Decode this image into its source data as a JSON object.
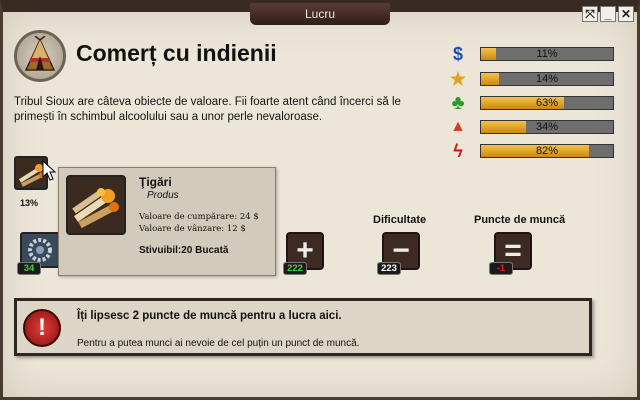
{
  "window": {
    "title": "Lucru",
    "controls": [
      {
        "name": "settings-icon",
        "glyph": "⤧"
      },
      {
        "name": "minimize-icon",
        "glyph": "_"
      },
      {
        "name": "close-icon",
        "glyph": "✕"
      }
    ]
  },
  "job": {
    "icon": "tepee-icon",
    "title": "Comerț cu indienii",
    "description": "Tribul Sioux are câteva obiecte de valoare. Fii foarte atent când încerci să le primești în schimbul alcoolului sau a unor perle nevaloroase."
  },
  "stats": [
    {
      "icon": "dollar-icon",
      "glyph": "$",
      "color": "#1d4fb8",
      "label": "11%",
      "value": 11
    },
    {
      "icon": "star-icon",
      "glyph": "★",
      "color": "#e0a21a",
      "label": "14%",
      "value": 14
    },
    {
      "icon": "clover-icon",
      "glyph": "♣",
      "color": "#2e9a2e",
      "label": "63%",
      "value": 63
    },
    {
      "icon": "warning-icon",
      "glyph": "▲",
      "color": "#c8461a",
      "label": "34%",
      "value": 34
    },
    {
      "icon": "injury-icon",
      "glyph": "ϟ",
      "color": "#cc1c1c",
      "label": "82%",
      "value": 82
    }
  ],
  "product": {
    "percent": "13%",
    "name": "Ţigări",
    "type": "Produs",
    "buy_value": "Valoare de cumpărare: 24 $",
    "sell_value": "Valoare de vânzare: 12 $",
    "stack": "Stivuibil:20 Bucată"
  },
  "skills": {
    "partial_count": "34",
    "plus_count": "222",
    "difficulty_label": "Dificultate",
    "difficulty_count": "223",
    "work_points_label": "Puncte de muncă",
    "work_points_count": "-1",
    "operators": {
      "plus": "+",
      "minus": "−",
      "equals": "="
    }
  },
  "message": {
    "title": "Îți lipsesc 2 puncte de muncă pentru a lucra aici.",
    "text": "Pentru a putea munci ai nevoie de cel puțin un punct de muncă.",
    "icon_glyph": "!"
  },
  "colors": {
    "positive": "#3fd23f",
    "negative": "#e02020",
    "neutral": "#ffffff"
  }
}
